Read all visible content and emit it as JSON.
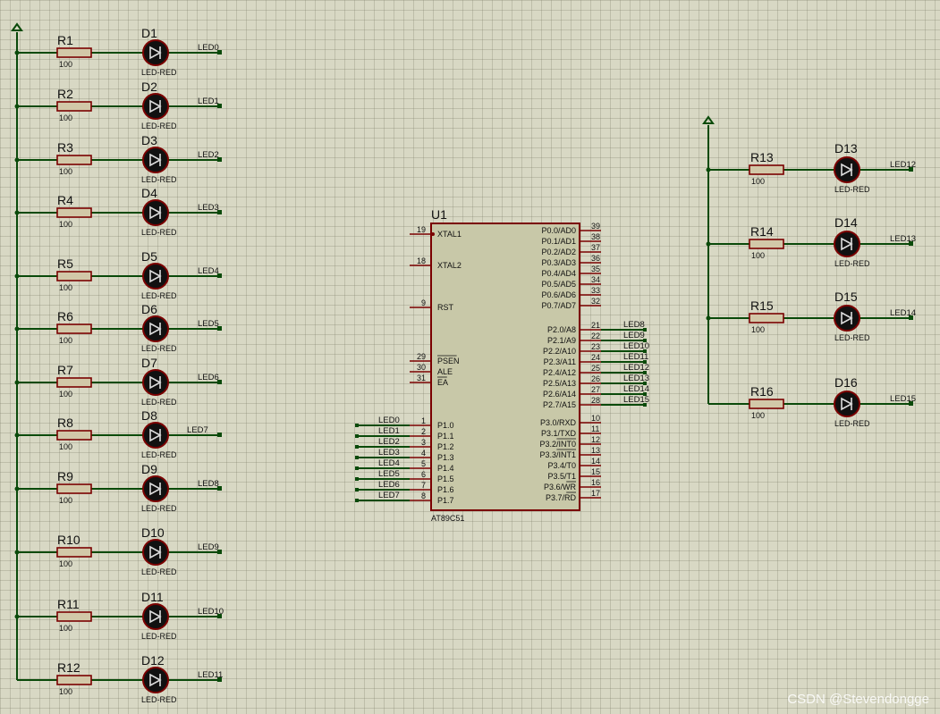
{
  "left_rails": [
    {
      "resistor": "R1",
      "value": "100",
      "led": "D1",
      "model": "LED-RED",
      "net": "LED0"
    },
    {
      "resistor": "R2",
      "value": "100",
      "led": "D2",
      "model": "LED-RED",
      "net": "LED1"
    },
    {
      "resistor": "R3",
      "value": "100",
      "led": "D3",
      "model": "LED-RED",
      "net": "LED2"
    },
    {
      "resistor": "R4",
      "value": "100",
      "led": "D4",
      "model": "LED-RED",
      "net": "LED3"
    },
    {
      "resistor": "R5",
      "value": "100",
      "led": "D5",
      "model": "LED-RED",
      "net": "LED4"
    },
    {
      "resistor": "R6",
      "value": "100",
      "led": "D6",
      "model": "LED-RED",
      "net": "LED5"
    },
    {
      "resistor": "R7",
      "value": "100",
      "led": "D7",
      "model": "LED-RED",
      "net": "LED6"
    },
    {
      "resistor": "R8",
      "value": "100",
      "led": "D8",
      "model": "LED-RED",
      "net": "LED7"
    },
    {
      "resistor": "R9",
      "value": "100",
      "led": "D9",
      "model": "LED-RED",
      "net": "LED8"
    },
    {
      "resistor": "R10",
      "value": "100",
      "led": "D10",
      "model": "LED-RED",
      "net": "LED9"
    },
    {
      "resistor": "R11",
      "value": "100",
      "led": "D11",
      "model": "LED-RED",
      "net": "LED10"
    },
    {
      "resistor": "R12",
      "value": "100",
      "led": "D12",
      "model": "LED-RED",
      "net": "LED11"
    }
  ],
  "right_rails": [
    {
      "resistor": "R13",
      "value": "100",
      "led": "D13",
      "model": "LED-RED",
      "net": "LED12"
    },
    {
      "resistor": "R14",
      "value": "100",
      "led": "D14",
      "model": "LED-RED",
      "net": "LED13"
    },
    {
      "resistor": "R15",
      "value": "100",
      "led": "D15",
      "model": "LED-RED",
      "net": "LED14"
    },
    {
      "resistor": "R16",
      "value": "100",
      "led": "D16",
      "model": "LED-RED",
      "net": "LED15"
    }
  ],
  "chip": {
    "ref": "U1",
    "part": "AT89C51",
    "left_pins": [
      {
        "num": "19",
        "name": "XTAL1"
      },
      {
        "num": "18",
        "name": "XTAL2"
      },
      {
        "num": "9",
        "name": "RST"
      },
      {
        "num": "29",
        "name": "PSEN",
        "overline": true
      },
      {
        "num": "30",
        "name": "ALE"
      },
      {
        "num": "31",
        "name": "EA",
        "overline": true
      },
      {
        "num": "1",
        "name": "P1.0",
        "net": "LED0"
      },
      {
        "num": "2",
        "name": "P1.1",
        "net": "LED1"
      },
      {
        "num": "3",
        "name": "P1.2",
        "net": "LED2"
      },
      {
        "num": "4",
        "name": "P1.3",
        "net": "LED3"
      },
      {
        "num": "5",
        "name": "P1.4",
        "net": "LED4"
      },
      {
        "num": "6",
        "name": "P1.5",
        "net": "LED5"
      },
      {
        "num": "7",
        "name": "P1.6",
        "net": "LED6"
      },
      {
        "num": "8",
        "name": "P1.7",
        "net": "LED7"
      }
    ],
    "right_pins": [
      {
        "num": "39",
        "name": "P0.0/AD0"
      },
      {
        "num": "38",
        "name": "P0.1/AD1"
      },
      {
        "num": "37",
        "name": "P0.2/AD2"
      },
      {
        "num": "36",
        "name": "P0.3/AD3"
      },
      {
        "num": "35",
        "name": "P0.4/AD4"
      },
      {
        "num": "34",
        "name": "P0.5/AD5"
      },
      {
        "num": "33",
        "name": "P0.6/AD6"
      },
      {
        "num": "32",
        "name": "P0.7/AD7"
      },
      {
        "num": "21",
        "name": "P2.0/A8",
        "net": "LED8"
      },
      {
        "num": "22",
        "name": "P2.1/A9",
        "net": "LED9"
      },
      {
        "num": "23",
        "name": "P2.2/A10",
        "net": "LED10"
      },
      {
        "num": "24",
        "name": "P2.3/A11",
        "net": "LED11"
      },
      {
        "num": "25",
        "name": "P2.4/A12",
        "net": "LED12"
      },
      {
        "num": "26",
        "name": "P2.5/A13",
        "net": "LED13"
      },
      {
        "num": "27",
        "name": "P2.6/A14",
        "net": "LED14"
      },
      {
        "num": "28",
        "name": "P2.7/A15",
        "net": "LED15"
      },
      {
        "num": "10",
        "name": "P3.0/RXD"
      },
      {
        "num": "11",
        "name": "P3.1/TXD"
      },
      {
        "num": "12",
        "name": "P3.2/INT0",
        "overline_part": "INT0"
      },
      {
        "num": "13",
        "name": "P3.3/INT1",
        "overline_part": "INT1"
      },
      {
        "num": "14",
        "name": "P3.4/T0"
      },
      {
        "num": "15",
        "name": "P3.5/T1"
      },
      {
        "num": "16",
        "name": "P3.6/WR",
        "overline_part": "WR"
      },
      {
        "num": "17",
        "name": "P3.7/RD",
        "overline_part": "RD"
      }
    ]
  },
  "watermark": "CSDN @Stevendongge",
  "colors": {
    "background": "#d8d8c4",
    "wire": "#0a4a0a",
    "component": "#7a0000",
    "chip_body": "#c8c8a8",
    "resistor_fill": "#d2c8a8",
    "led_fill": "#111111"
  }
}
